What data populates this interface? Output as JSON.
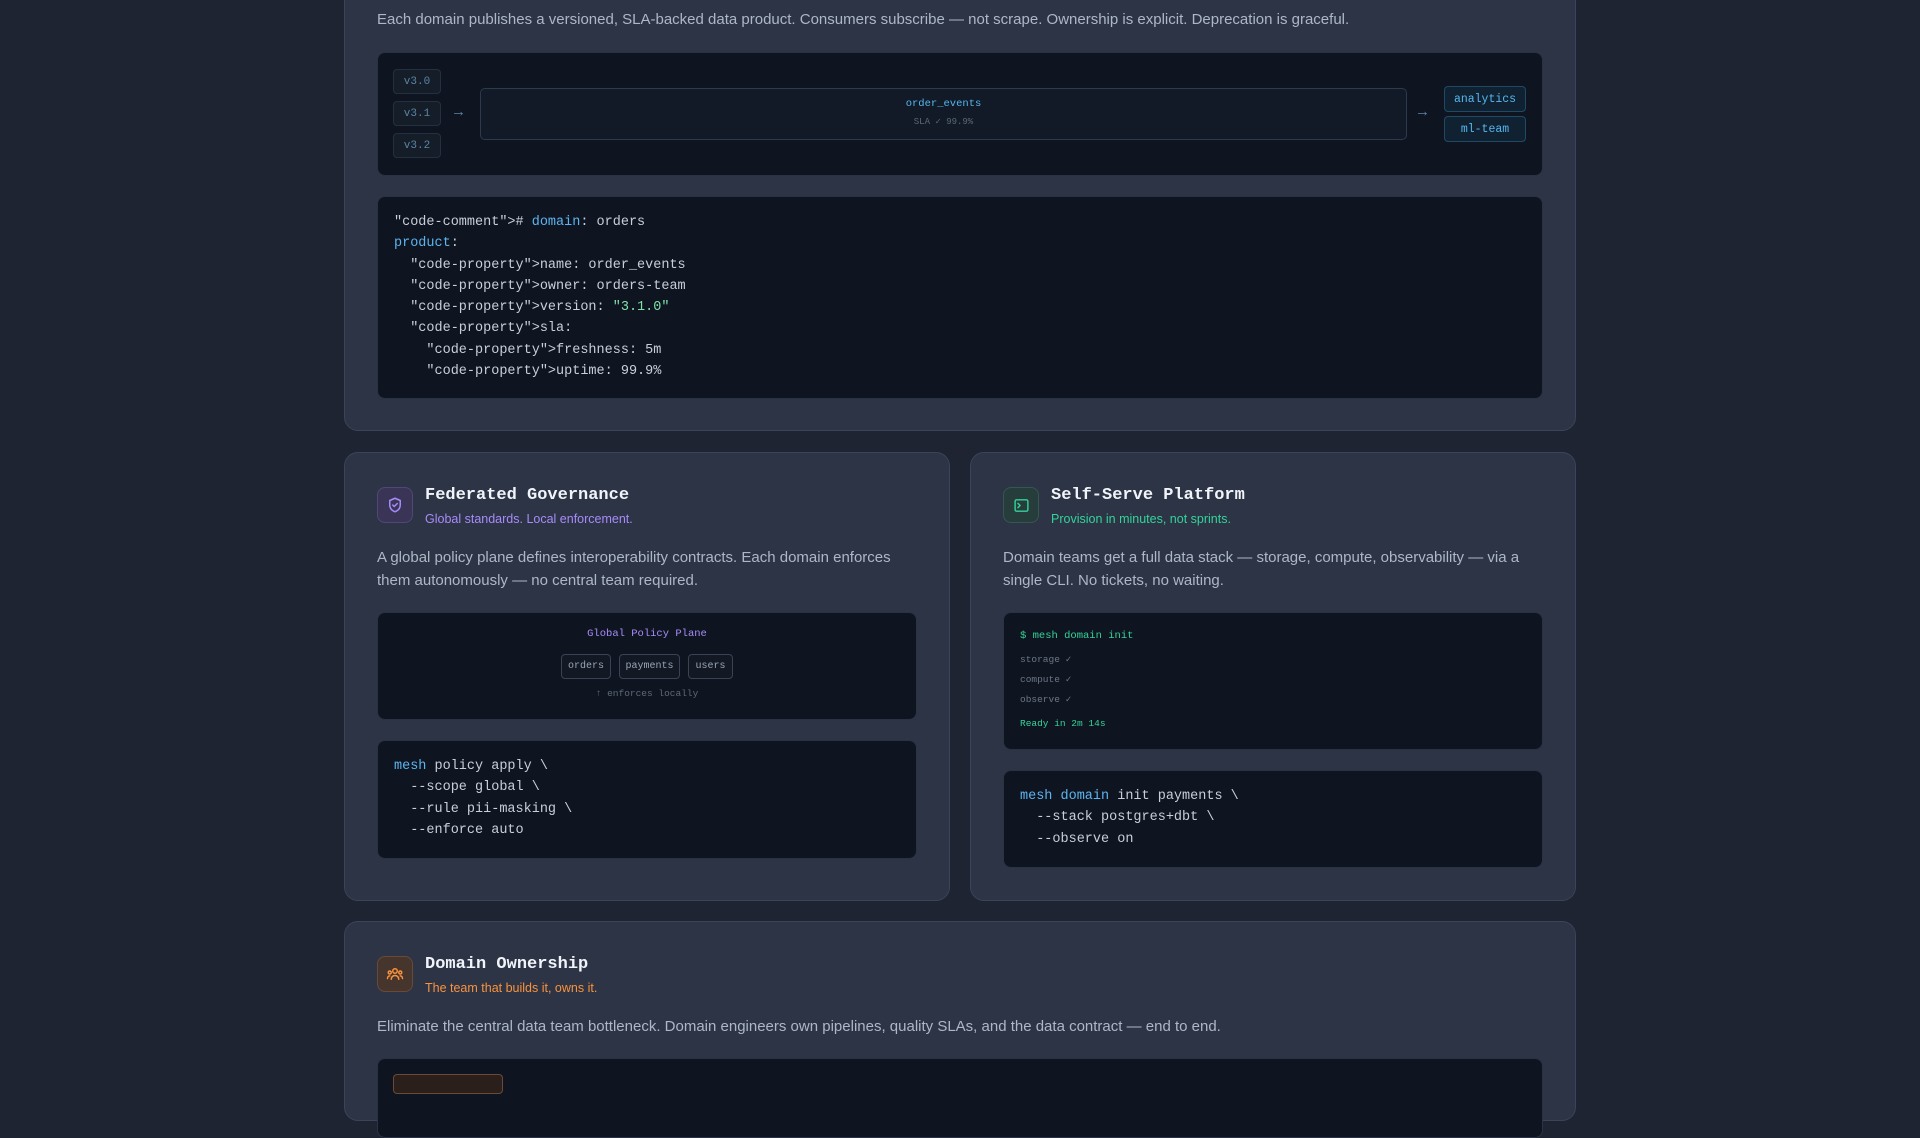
{
  "top_card": {
    "description": "Each domain publishes a versioned, SLA-backed data product. Consumers subscribe — not scrape. Ownership is explicit. Deprecation is graceful.",
    "versions": [
      "v3.0",
      "v3.1",
      "v3.2"
    ],
    "product_name": "order_events",
    "product_sla": "SLA ✓ 99.9%",
    "consumers": [
      "analytics",
      "ml-team"
    ],
    "arrow_glyph": "→",
    "code": {
      "line1_prefix": "\"code-comment\"># ",
      "line1_key": "domain",
      "line1_rest": ": orders",
      "line2_key": "product",
      "line2_rest": ":",
      "line3": "  \"code-property\">name: order_events",
      "line4": "  \"code-property\">owner: orders-team",
      "line5_prefix": "  \"code-property\">version: ",
      "line5_value": "\"3.1.0\"",
      "line6": "  \"code-property\">sla:",
      "line7": "    \"code-property\">freshness: 5m",
      "line8": "    \"code-property\">uptime: 99.9%"
    }
  },
  "governance": {
    "title": "Federated Governance",
    "subtitle": "Global standards. Local enforcement.",
    "description": "A global policy plane defines interoperability contracts. Each domain enforces them autonomously — no central team required.",
    "plane_label": "Global Policy Plane",
    "domains": [
      "orders",
      "payments",
      "users"
    ],
    "enforce_note": "↑ enforces locally",
    "code": {
      "line1_kw": "mesh",
      "line1_rest": " policy apply \\",
      "line2": "  --scope global \\",
      "line3": "  --rule pii-masking \\",
      "line4": "  --enforce auto"
    }
  },
  "platform": {
    "title": "Self-Serve Platform",
    "subtitle": "Provision in minutes, not sprints.",
    "description": "Domain teams get a full data stack — storage, compute, observability — via a single CLI. No tickets, no waiting.",
    "terminal": {
      "command": "$ mesh domain init",
      "steps": [
        "storage ✓",
        "compute ✓",
        "observe ✓"
      ],
      "ready": "Ready in 2m 14s"
    },
    "code": {
      "line1_kw": "mesh domain",
      "line1_rest": " init payments \\",
      "line2": "  --stack postgres+dbt \\",
      "line3": "  --observe on"
    }
  },
  "ownership": {
    "title": "Domain Ownership",
    "subtitle": "The team that builds it, owns it.",
    "description": "Eliminate the central data team bottleneck. Domain engineers own pipelines, quality SLAs, and the data contract — end to end."
  },
  "colors": {
    "background": "#1e2431",
    "card": "#2c3446",
    "accent_blue": "#5db4f0",
    "accent_purple": "#a78bfa",
    "accent_green": "#34d399",
    "accent_orange": "#fb923c"
  }
}
